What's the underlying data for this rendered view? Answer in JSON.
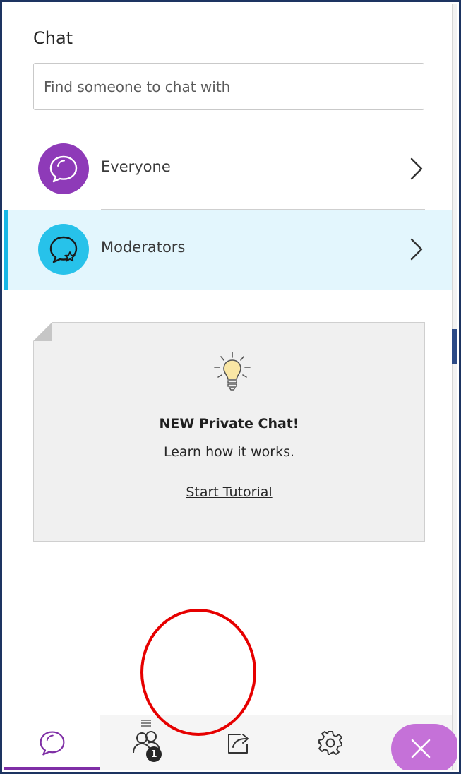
{
  "chat": {
    "title": "Chat",
    "search_placeholder": "Find someone to chat with"
  },
  "channels": [
    {
      "label": "Everyone",
      "avatar_color": "#8e3ab8",
      "icon": "chat-bubble-icon"
    },
    {
      "label": "Moderators",
      "avatar_color": "#27c2ea",
      "icon": "moderator-chat-icon",
      "selected": true
    }
  ],
  "tutorial_card": {
    "icon": "lightbulb-icon",
    "title": "NEW Private Chat!",
    "subtitle": "Learn how it works.",
    "link": "Start Tutorial"
  },
  "bottom_bar": {
    "tabs": [
      {
        "name": "chat",
        "icon": "chat-bubble-icon",
        "active": true
      },
      {
        "name": "attendees",
        "icon": "attendees-icon",
        "badge": "1"
      },
      {
        "name": "share-content",
        "icon": "share-icon"
      },
      {
        "name": "settings",
        "icon": "gear-icon"
      }
    ],
    "close_icon": "close-icon"
  },
  "colors": {
    "accent_purple": "#7f2fa6",
    "selected_row": "#e3f6fd",
    "selected_accent": "#18b6e6",
    "annotation_red": "#e60000"
  }
}
